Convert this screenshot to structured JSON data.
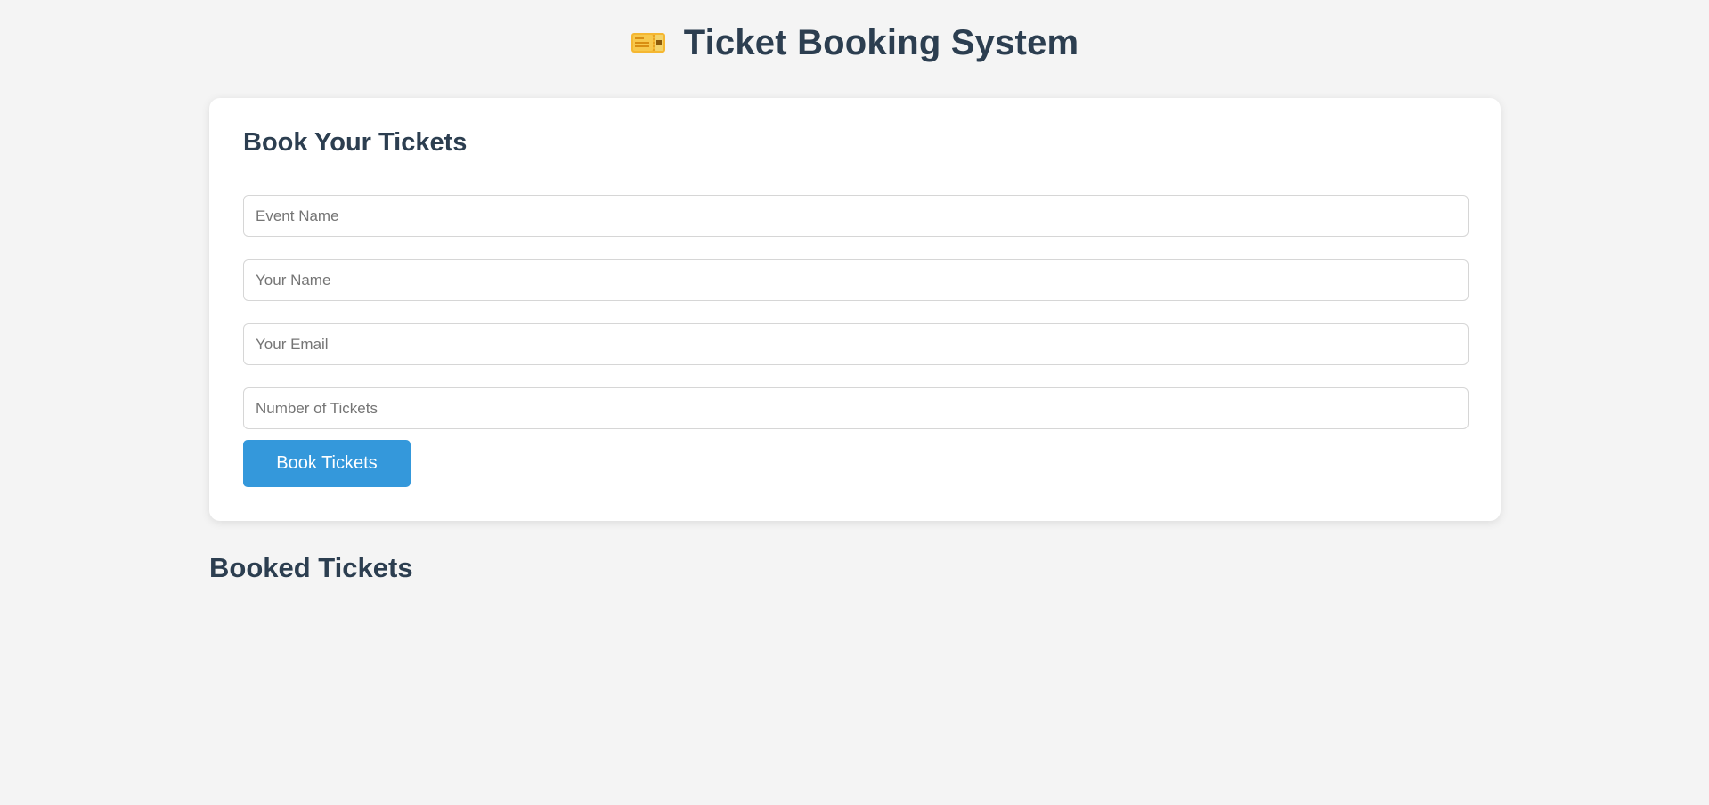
{
  "header": {
    "icon": "ticket-icon",
    "title": "Ticket Booking System"
  },
  "form": {
    "title": "Book Your Tickets",
    "event_name": {
      "placeholder": "Event Name",
      "value": ""
    },
    "your_name": {
      "placeholder": "Your Name",
      "value": ""
    },
    "your_email": {
      "placeholder": "Your Email",
      "value": ""
    },
    "num_tickets": {
      "placeholder": "Number of Tickets",
      "value": ""
    },
    "submit_label": "Book Tickets"
  },
  "booked": {
    "title": "Booked Tickets",
    "items": []
  },
  "colors": {
    "background": "#f4f4f4",
    "text": "#2c3e50",
    "accent": "#3498db",
    "ticket_icon": "#f4c542"
  }
}
